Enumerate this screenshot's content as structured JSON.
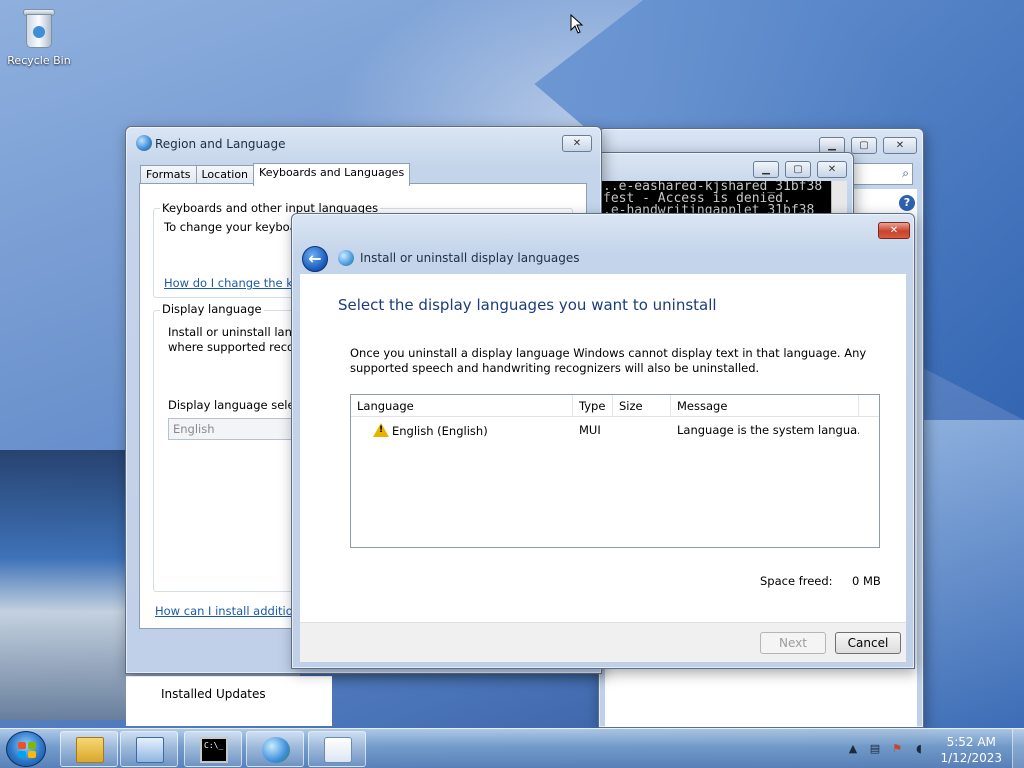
{
  "desktop": {
    "recycle_bin_label": "Recycle Bin"
  },
  "cmd": {
    "lines": [
      "..e-eashared-kjshared_31bf38",
      "fest - Access is denied.",
      ".e-handwritingapplet_31bf38"
    ]
  },
  "region_window": {
    "title": "Region and Language",
    "tabs": [
      "Formats",
      "Location",
      "Keyboards and Languages"
    ],
    "active_tab": "Keyboards and Languages",
    "keyboards_group_label": "Keyboards and other input languages",
    "keyboards_text": "To change your keyboar",
    "keyboards_link": "How do I change the ke",
    "display_group_label": "Display language",
    "display_text_1": "Install or uninstall langu",
    "display_text_2": "where supported recog",
    "display_select_label": "Display language select",
    "display_select_value": "English",
    "install_link": "How can I install additiona"
  },
  "background_window": {
    "installed_updates_label": "Installed Updates"
  },
  "dialog": {
    "title": "Install or uninstall display languages",
    "heading": "Select the display languages you want to uninstall",
    "description": "Once you uninstall a display language Windows cannot display text in that language. Any supported speech and handwriting recognizers will also be uninstalled.",
    "columns": {
      "language": "Language",
      "type": "Type",
      "size": "Size",
      "message": "Message"
    },
    "rows": [
      {
        "language": "English (English)",
        "type": "MUI",
        "size": "",
        "message": "Language is the system langua..."
      }
    ],
    "space_freed_label": "Space freed:",
    "space_freed_value": "0 MB",
    "next_label": "Next",
    "cancel_label": "Cancel"
  },
  "taskbar": {
    "time": "5:52 AM",
    "date": "1/12/2023",
    "pinned": [
      "explorer-icon",
      "control-panel-icon",
      "cmd-icon",
      "network-globe-icon",
      "region-language-icon"
    ]
  },
  "colors": {
    "link": "#1c5aa8",
    "heading": "#1c3d7a",
    "close_red": "#c8432c"
  }
}
